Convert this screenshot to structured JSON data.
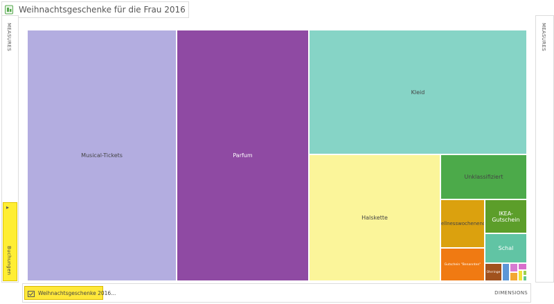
{
  "title": "Weihnachtsgeschenke für die Frau 2016",
  "left_panel": {
    "label": "MEASURES",
    "yellow_label": "Buchungen"
  },
  "right_panel": {
    "label": "MEASURES"
  },
  "bottom_bar": {
    "chip_label": "Weihnachtsgeschenke 2016...",
    "dims_label": "DIMENSIONS"
  },
  "icons": {
    "title": "treemap-doc-icon",
    "chevron": "chevron-right-icon",
    "chip": "list-check-icon"
  },
  "treemap": {
    "tiles": [
      {
        "label": "Musical-Tickets",
        "color": "#b3ade0"
      },
      {
        "label": "Parfum",
        "color": "#8f4aa3"
      },
      {
        "label": "Kleid",
        "color": "#86d4c6"
      },
      {
        "label": "Halskette",
        "color": "#fbf59a"
      },
      {
        "label": "Unklassifiziert",
        "color": "#4caa4a"
      },
      {
        "label": "Wellnesswochenende",
        "color": "#dba10e"
      },
      {
        "label": "IKEA-Gutschein",
        "color": "#5c9e2a"
      },
      {
        "label": "Schal",
        "color": "#61c4a4"
      },
      {
        "label": "Gutschein \"Benannten\"",
        "color": "#f07a12"
      },
      {
        "label": "Ohrringe",
        "color": "#a1521e"
      },
      {
        "label": "",
        "color": "#5d97d6"
      },
      {
        "label": "",
        "color": "#d77bd2"
      },
      {
        "label": "",
        "color": "#f3a832"
      },
      {
        "label": "",
        "color": "#d86fcc"
      },
      {
        "label": "",
        "color": "#f0e23a"
      },
      {
        "label": "",
        "color": "#9ed14c"
      },
      {
        "label": "",
        "color": "#63c88a"
      }
    ]
  }
}
